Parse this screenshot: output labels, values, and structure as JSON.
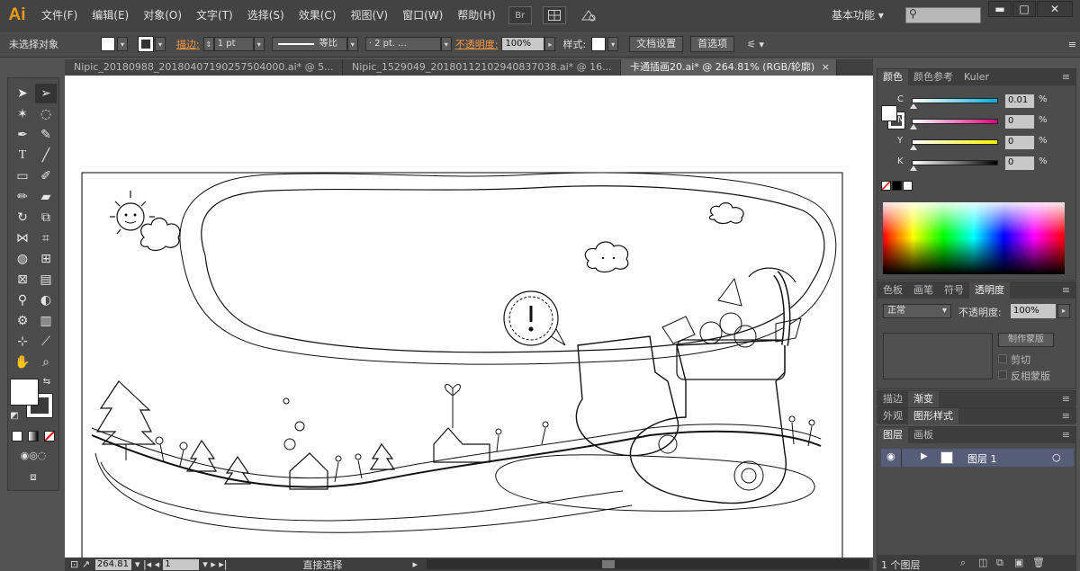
{
  "app": {
    "logo": "Ai",
    "menu": [
      "文件(F)",
      "编辑(E)",
      "对象(O)",
      "文字(T)",
      "选择(S)",
      "效果(C)",
      "视图(V)",
      "窗口(W)",
      "帮助(H)"
    ],
    "bridge_icon": "Br",
    "workspace": "基本功能",
    "search_icon": "search-icon"
  },
  "control": {
    "selection_status": "未选择对象",
    "stroke_label": "描边:",
    "stroke_weight": "1 pt",
    "stroke_profile": "等比",
    "brush_value": "· 2 pt. ...",
    "opacity_label": "不透明度:",
    "opacity_value": "100%",
    "style_label": "样式:",
    "document_setup": "文档设置",
    "preferences": "首选项"
  },
  "tabs": [
    {
      "label": "Nipic_20180988_20180407190257504000.ai* @ 5...",
      "close": "×"
    },
    {
      "label": "Nipic_1529049_20180112102940837038.ai* @ 16...",
      "close": "×"
    },
    {
      "label": "卡通插画20.ai* @ 264.81% (RGB/轮廓)",
      "close": "×"
    }
  ],
  "status": {
    "zoom": "264.81",
    "page": "1",
    "tool_name": "直接选择"
  },
  "color_panel": {
    "tabs": [
      "颜色",
      "颜色参考",
      "Kuler"
    ],
    "channels": [
      {
        "label": "C",
        "value": "0.01",
        "pct": "%",
        "color": "#00aee8"
      },
      {
        "label": "M",
        "value": "0",
        "pct": "%",
        "color": "#e5007f"
      },
      {
        "label": "Y",
        "value": "0",
        "pct": "%",
        "color": "#fff000"
      },
      {
        "label": "K",
        "value": "0",
        "pct": "%",
        "color": "#000000"
      }
    ]
  },
  "transparency_panel": {
    "tabs": [
      "色板",
      "画笔",
      "符号",
      "透明度"
    ],
    "mode": "正常",
    "opacity_label": "不透明度:",
    "opacity_value": "100%",
    "make_mask": "制作蒙版",
    "clip": "剪切",
    "invert_mask": "反相蒙版"
  },
  "stroke_panel": {
    "tabs": [
      "描边",
      "渐变"
    ]
  },
  "appearance_panel": {
    "tabs": [
      "外观",
      "图形样式"
    ]
  },
  "layers_panel": {
    "tabs": [
      "图层",
      "画板"
    ],
    "layer_name": "图层 1",
    "footer": "1 个图层"
  }
}
